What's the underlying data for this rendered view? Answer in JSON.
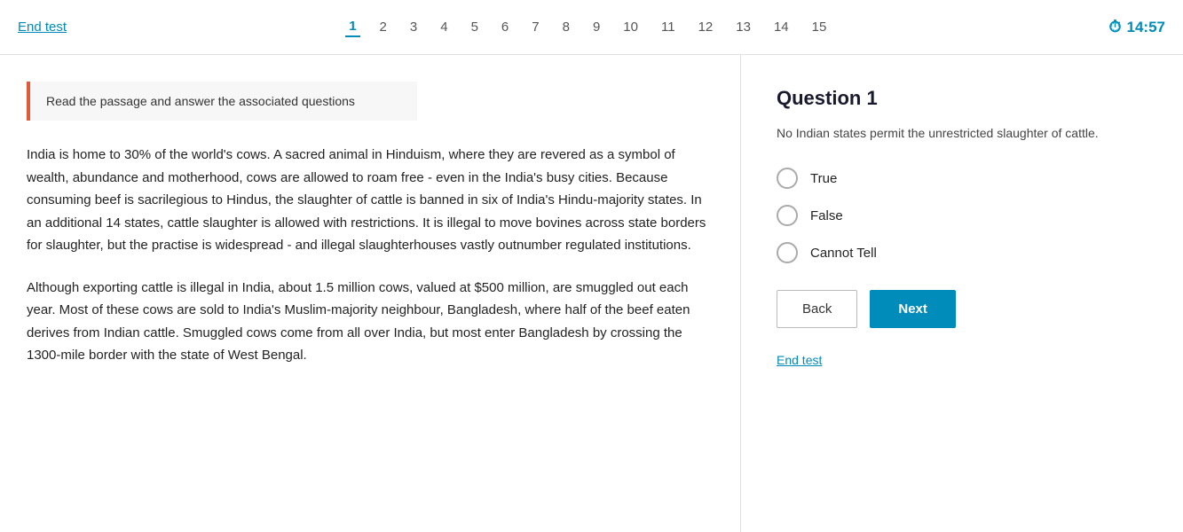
{
  "header": {
    "end_test_label": "End test",
    "timer_value": "14:57",
    "nav_numbers": [
      "1",
      "2",
      "3",
      "4",
      "5",
      "6",
      "7",
      "8",
      "9",
      "10",
      "11",
      "12",
      "13",
      "14",
      "15"
    ],
    "active_num": "1"
  },
  "instruction": {
    "text": "Read the passage and answer the associated questions"
  },
  "passage": {
    "paragraph1": "India is home to 30% of the world's cows. A sacred animal in Hinduism, where they are revered as a symbol of wealth, abundance and motherhood, cows are allowed to roam free - even in the India's busy cities. Because consuming beef is sacrilegious to Hindus, the slaughter of cattle is banned in six of India's Hindu-majority states. In an additional 14 states, cattle slaughter is allowed with restrictions. It is illegal to move bovines across state borders for slaughter, but the practise is widespread - and illegal slaughterhouses vastly outnumber regulated institutions.",
    "paragraph2": "Although exporting cattle is illegal in India, about 1.5 million cows, valued at $500 million, are smuggled out each year. Most of these cows are sold to India's Muslim-majority neighbour, Bangladesh, where half of the beef eaten derives from Indian cattle. Smuggled cows come from all over India, but most enter Bangladesh by crossing the 1300-mile border with the state of West Bengal."
  },
  "question": {
    "title": "Question 1",
    "text": "No Indian states permit the unrestricted slaughter of cattle.",
    "options": [
      {
        "label": "True",
        "id": "opt-true"
      },
      {
        "label": "False",
        "id": "opt-false"
      },
      {
        "label": "Cannot Tell",
        "id": "opt-cannot"
      }
    ],
    "back_label": "Back",
    "next_label": "Next",
    "end_test_label": "End test"
  }
}
